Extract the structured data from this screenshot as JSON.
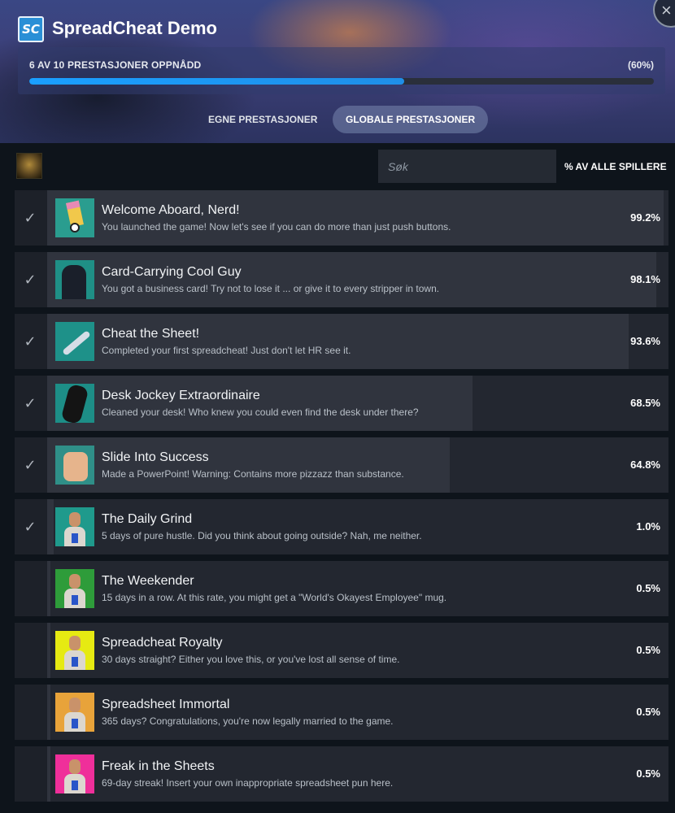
{
  "app": {
    "logo_text": "SC",
    "title": "SpreadCheat Demo",
    "close_glyph": "×"
  },
  "progress": {
    "label": "6 AV 10 PRESTASJONER OPPNÅDD",
    "percent_label": "(60%)",
    "fraction": 0.6,
    "color": "#1a9fff"
  },
  "tabs": [
    {
      "label": "EGNE PRESTASJONER",
      "active": false
    },
    {
      "label": "GLOBALE PRESTASJONER",
      "active": true
    }
  ],
  "search": {
    "placeholder": "Søk"
  },
  "sort_label": "% AV ALLE SPILLERE",
  "check_glyph": "✓",
  "achievements": [
    {
      "name": "Welcome Aboard, Nerd!",
      "desc": "You launched the game! Now let's see if you can do more than just push buttons.",
      "percent": "99.2%",
      "value": 99.2,
      "unlocked": true,
      "icon": "pencil-character-icon",
      "icon_bg": "#2a9d8f"
    },
    {
      "name": "Card-Carrying Cool Guy",
      "desc": "You got a business card! Try not to lose it ... or give it to every stripper in town.",
      "percent": "98.1%",
      "value": 98.1,
      "unlocked": true,
      "icon": "hooded-figure-icon",
      "icon_bg": "#1f8f86"
    },
    {
      "name": "Cheat the Sheet!",
      "desc": "Completed your first spreadcheat! Just don't let HR see it.",
      "percent": "93.6%",
      "value": 93.6,
      "unlocked": true,
      "icon": "swordfish-icon",
      "icon_bg": "#1e9189"
    },
    {
      "name": "Desk Jockey Extraordinaire",
      "desc": "Cleaned your desk! Who knew you could even find the desk under there?",
      "percent": "68.5%",
      "value": 68.5,
      "unlocked": true,
      "icon": "dark-creature-icon",
      "icon_bg": "#1d8e87"
    },
    {
      "name": "Slide Into Success",
      "desc": "Made a PowerPoint! Warning: Contains more pizzazz than substance.",
      "percent": "64.8%",
      "value": 64.8,
      "unlocked": true,
      "icon": "hand-icon",
      "icon_bg": "#2f8f88"
    },
    {
      "name": "The Daily Grind",
      "desc": "5 days of pure hustle. Did you think about going outside? Nah, me neither.",
      "percent": "1.0%",
      "value": 1.0,
      "unlocked": true,
      "icon": "portrait-teal-icon",
      "icon_bg": "#1f9a8c"
    },
    {
      "name": "The Weekender",
      "desc": "15 days in a row. At this rate, you might get a \"World's Okayest Employee\" mug.",
      "percent": "0.5%",
      "value": 0.5,
      "unlocked": false,
      "icon": "portrait-green-icon",
      "icon_bg": "#2e9c3a"
    },
    {
      "name": "Spreadcheat Royalty",
      "desc": "30 days straight? Either you love this, or you've lost all sense of time.",
      "percent": "0.5%",
      "value": 0.5,
      "unlocked": false,
      "icon": "portrait-yellow-icon",
      "icon_bg": "#e6ea12"
    },
    {
      "name": "Spreadsheet Immortal",
      "desc": "365 days? Congratulations, you're now legally married to the game.",
      "percent": "0.5%",
      "value": 0.5,
      "unlocked": false,
      "icon": "portrait-sunset-icon",
      "icon_bg": "#e8a33a"
    },
    {
      "name": "Freak in the Sheets",
      "desc": "69-day streak! Insert your own inappropriate spreadsheet pun here.",
      "percent": "0.5%",
      "value": 0.5,
      "unlocked": false,
      "icon": "portrait-pink-icon",
      "icon_bg": "#ef2f9a"
    }
  ]
}
